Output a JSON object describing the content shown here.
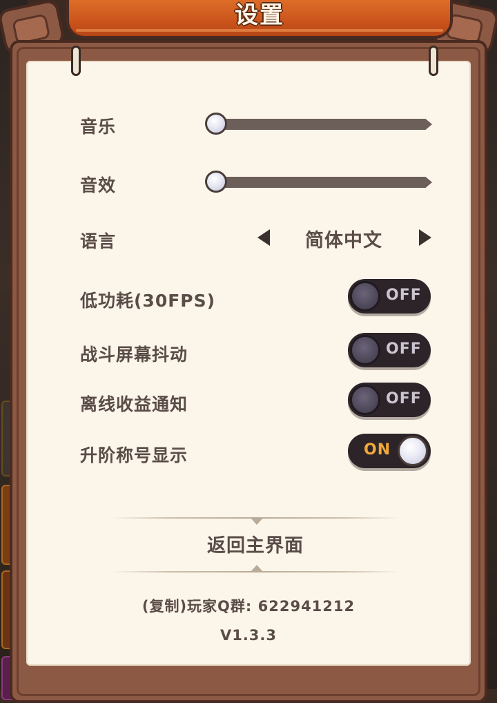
{
  "title": "设置",
  "settings": {
    "music": {
      "label": "音乐",
      "value": 0
    },
    "sfx": {
      "label": "音效",
      "value": 0
    },
    "language": {
      "label": "语言",
      "value": "简体中文"
    },
    "toggles": [
      {
        "label": "低功耗(30FPS)",
        "state": "OFF",
        "on": false
      },
      {
        "label": "战斗屏幕抖动",
        "state": "OFF",
        "on": false
      },
      {
        "label": "离线收益通知",
        "state": "OFF",
        "on": false
      },
      {
        "label": "升阶称号显示",
        "state": "ON",
        "on": true
      }
    ]
  },
  "return_button": "返回主界面",
  "group_info": "(复制)玩家Q群: 622941212",
  "version": "V1.3.3",
  "colors": {
    "banner": "#c9521b",
    "paper": "#fbf5ea",
    "frame": "#8c5a44",
    "label_text": "#5a4c47",
    "toggle_bg": "#2c2428",
    "on_text": "#f2a93b"
  }
}
